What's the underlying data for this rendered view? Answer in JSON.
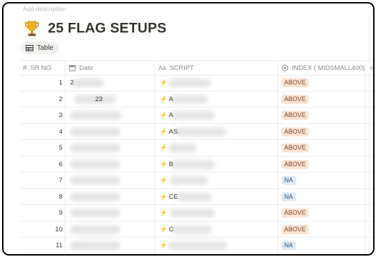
{
  "page": {
    "description_placeholder": "Add description",
    "title": "25 FLAG SETUPS",
    "view_tab_label": "Table"
  },
  "columns": {
    "sr": "SR NO.",
    "date": "Date",
    "script": "SCRIPT",
    "index": "INDEX ( MIDSMALL400)"
  },
  "rows": [
    {
      "sr": "1",
      "date_visible": "2",
      "script_visible": "",
      "index": "ABOVE"
    },
    {
      "sr": "2",
      "date_visible": "23",
      "script_visible": "A",
      "index": "ABOVE"
    },
    {
      "sr": "3",
      "date_visible": "",
      "script_visible": "A",
      "index": "ABOVE"
    },
    {
      "sr": "4",
      "date_visible": "",
      "script_visible": "AS",
      "index": "ABOVE"
    },
    {
      "sr": "5",
      "date_visible": "",
      "script_visible": "",
      "index": "ABOVE"
    },
    {
      "sr": "6",
      "date_visible": "",
      "script_visible": "B",
      "index": "ABOVE"
    },
    {
      "sr": "7",
      "date_visible": "",
      "script_visible": "",
      "index": "NA"
    },
    {
      "sr": "8",
      "date_visible": "",
      "script_visible": "CE",
      "index": "NA"
    },
    {
      "sr": "9",
      "date_visible": "",
      "script_visible": "",
      "index": "ABOVE"
    },
    {
      "sr": "10",
      "date_visible": "",
      "script_visible": "C",
      "index": "ABOVE"
    },
    {
      "sr": "11",
      "date_visible": "",
      "script_visible": "",
      "index": "NA"
    }
  ],
  "colors": {
    "above_bg": "#fbe3d2",
    "na_bg": "#dcebf7",
    "bolt": "#f5a623"
  },
  "icons": {
    "title": "trophy-icon",
    "view_tab": "table-icon",
    "sr_header": "hash-icon",
    "date_header": "calendar-icon",
    "script_header": "text-aa-icon",
    "index_header": "select-circle-icon",
    "script_cell": "lightning-icon",
    "add_column": "plus-icon"
  }
}
